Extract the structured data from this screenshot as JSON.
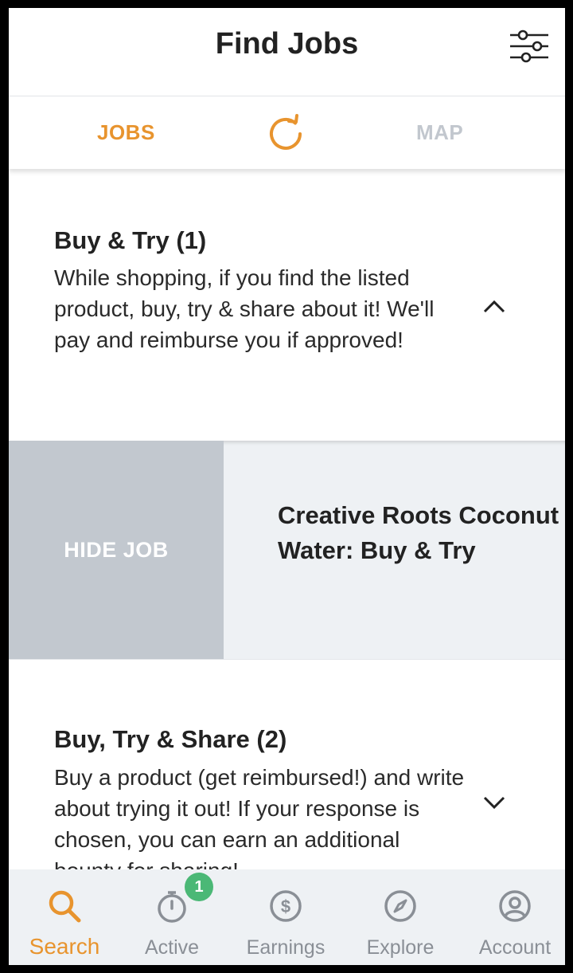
{
  "header": {
    "title": "Find Jobs"
  },
  "tabs": {
    "jobs": "JOBS",
    "map": "MAP"
  },
  "sections": [
    {
      "title": "Buy & Try (1)",
      "description": "While shopping, if you find the listed product, buy, try & share about it! We'll pay and reimburse you if approved!",
      "expanded": true
    },
    {
      "title": "Buy, Try & Share (2)",
      "description": "Buy a product (get reimbursed!) and write about trying it out! If your response is chosen, you can earn an additional bounty for sharing!",
      "expanded": false
    }
  ],
  "job": {
    "hide_label": "HIDE JOB",
    "title": "Creative Roots Coconut Water: Buy & Try"
  },
  "nav": {
    "items": [
      {
        "label": "Search",
        "icon": "search-icon",
        "active": true
      },
      {
        "label": "Active",
        "icon": "stopwatch-icon",
        "badge": "1"
      },
      {
        "label": "Earnings",
        "icon": "dollar-icon"
      },
      {
        "label": "Explore",
        "icon": "compass-icon"
      },
      {
        "label": "Account",
        "icon": "user-icon"
      }
    ]
  },
  "colors": {
    "accent": "#e8942e",
    "badge": "#4bb876",
    "muted": "#c2c7ce"
  }
}
